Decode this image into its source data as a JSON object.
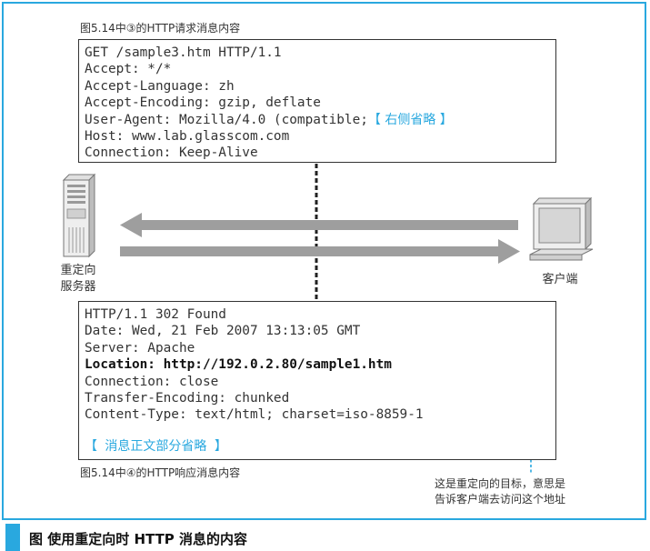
{
  "request": {
    "caption": "图5.14中③的HTTP请求消息内容",
    "lines": [
      "GET /sample3.htm HTTP/1.1",
      "Accept: */*",
      "Accept-Language: zh",
      "Accept-Encoding: gzip, deflate",
      "Host: www.lab.glasscom.com",
      "Connection: Keep-Alive"
    ],
    "user_agent_prefix": "User-Agent: Mozilla/4.0 (compatible;",
    "user_agent_omitted": "【 右侧省略 】"
  },
  "server": {
    "label_line1": "重定向",
    "label_line2": "服务器"
  },
  "client": {
    "label": "客户端"
  },
  "response": {
    "caption": "图5.14中④的HTTP响应消息内容",
    "lines_before": [
      "HTTP/1.1 302 Found",
      "Date: Wed, 21 Feb 2007 13:13:05 GMT",
      "Server: Apache"
    ],
    "location_line": "Location: http://192.0.2.80/sample1.htm",
    "lines_after": [
      "Connection: close",
      "Transfer-Encoding: chunked",
      "Content-Type: text/html; charset=iso-8859-1"
    ],
    "body_omitted": "【 消息正文部分省略 】"
  },
  "annotation": {
    "line1": "这是重定向的目标，意思是",
    "line2": "告诉客户端去访问这个地址"
  },
  "figure_title": "图  使用重定向时 HTTP 消息的内容",
  "colors": {
    "accent": "#29a8df",
    "arrow": "#9e9e9e",
    "text": "#333333"
  }
}
